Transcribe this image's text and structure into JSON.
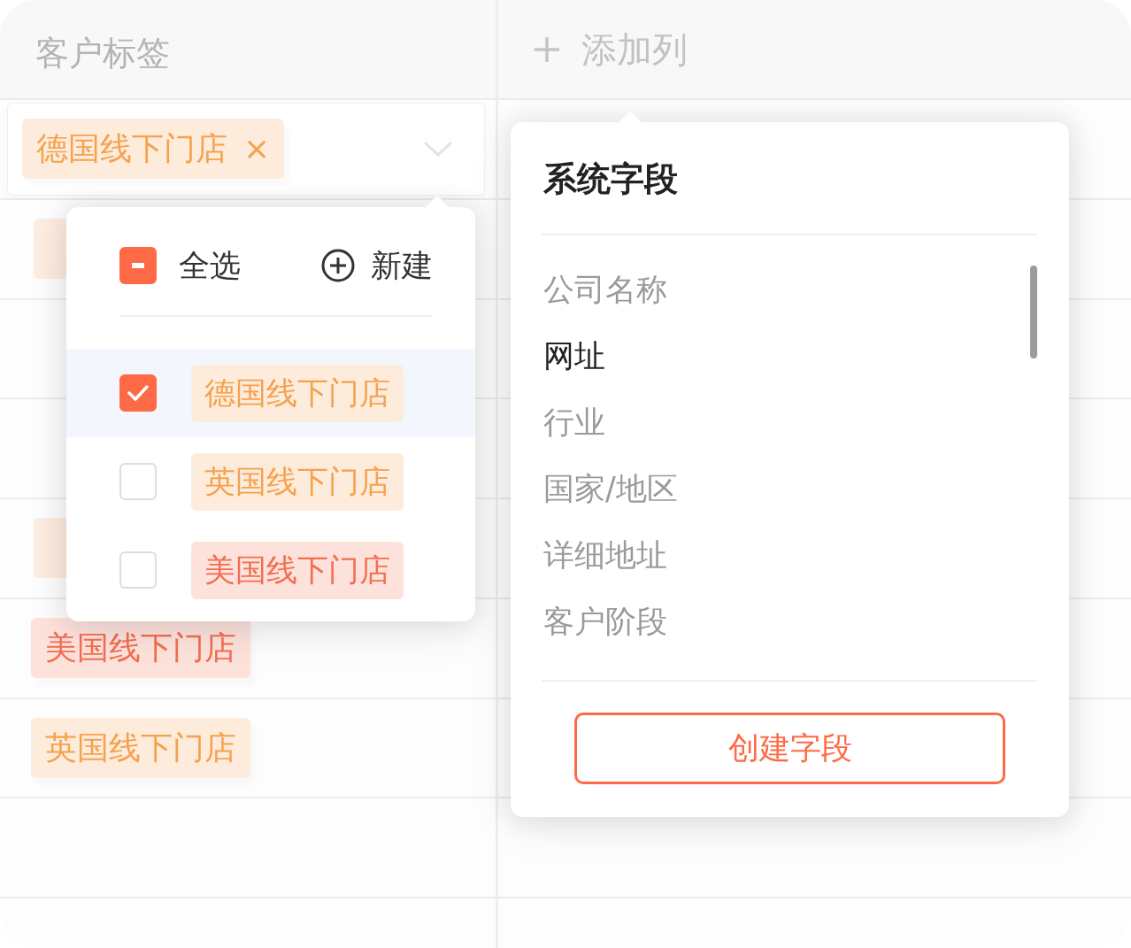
{
  "table": {
    "columns": [
      {
        "label": "客户标签",
        "kind": "text"
      },
      {
        "label": "添加列",
        "kind": "add"
      }
    ],
    "rows": [
      {
        "kind": "select",
        "tags": [
          {
            "label": "德国线下门店",
            "color": "#f5a24e",
            "remove": "×"
          }
        ]
      },
      {
        "kind": "covered"
      },
      {
        "kind": "empty"
      },
      {
        "kind": "empty"
      },
      {
        "kind": "covered"
      },
      {
        "kind": "tag",
        "tag": {
          "label": "美国线下门店",
          "color": "#f36e4f"
        }
      },
      {
        "kind": "tag",
        "tag": {
          "label": "英国线下门店",
          "color": "#f5a24e"
        }
      },
      {
        "kind": "empty"
      },
      {
        "kind": "empty"
      }
    ]
  },
  "tag_dropdown": {
    "select_all": {
      "label": "全选",
      "checked": false,
      "indeterminate": true
    },
    "new_button": {
      "label": "新建"
    },
    "options": [
      {
        "label": "德国线下门店",
        "color": "#f5a24e",
        "checked": true,
        "highlighted": true
      },
      {
        "label": "英国线下门店",
        "color": "#f5a24e",
        "checked": false,
        "highlighted": false
      },
      {
        "label": "美国线下门店",
        "color": "#f36e4f",
        "checked": false,
        "highlighted": false
      }
    ]
  },
  "field_dropdown": {
    "title": "系统字段",
    "fields": [
      {
        "label": "公司名称",
        "disabled": true
      },
      {
        "label": "网址",
        "disabled": false
      },
      {
        "label": "行业",
        "disabled": true
      },
      {
        "label": "国家/地区",
        "disabled": true
      },
      {
        "label": "详细地址",
        "disabled": true
      },
      {
        "label": "客户阶段",
        "disabled": true
      }
    ],
    "create_button": {
      "label": "创建字段"
    }
  }
}
